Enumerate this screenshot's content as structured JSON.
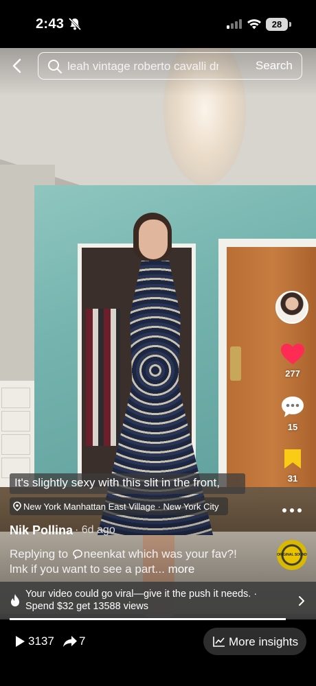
{
  "status_bar": {
    "time": "2:43",
    "battery": "28"
  },
  "search": {
    "query": "leah vintage roberto cavalli dr...",
    "button_label": "Search"
  },
  "actions": {
    "likes": "277",
    "comments": "15",
    "favorites": "31",
    "like_color": "#fe2c55",
    "favorite_color": "#facc15"
  },
  "video": {
    "caption": "It's slightly sexy with this slit in the front,",
    "location": "New York Manhattan East Village · New York City",
    "username": "Nik Pollina",
    "time_ago": "· 6d ago",
    "reply_prefix": "Replying to",
    "reply_user": "neenkat",
    "description_rest": "which was your fav?! lmk if you want to see a part...",
    "more_label": "more",
    "music_label": "ORIGINAL SOUND",
    "progress_fraction": 1.0
  },
  "promo": {
    "text": "Your video could go viral—give it the push it needs. · Spend $32 get 13588 views"
  },
  "stats": {
    "plays": "3137",
    "shares": "7"
  },
  "insights_button": "More insights"
}
